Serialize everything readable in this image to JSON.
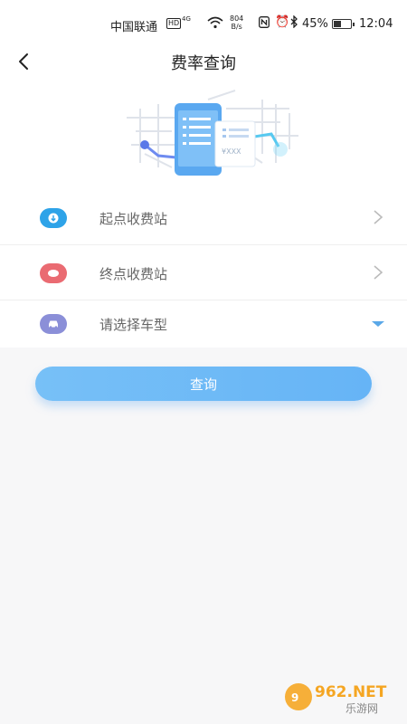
{
  "status": {
    "carrier": "中国联通",
    "hd": "HD",
    "network_type": "4G",
    "speed_value": "804",
    "speed_unit": "B/s",
    "battery": "45%",
    "battery_level": 0.45,
    "time": "12:04"
  },
  "header": {
    "title": "费率查询"
  },
  "hero": {
    "price_text": "¥XXX"
  },
  "form": {
    "start_station": "起点收费站",
    "end_station": "终点收费站",
    "vehicle_type": "请选择车型"
  },
  "query_button": "查询",
  "watermark": {
    "brand": "962.NET",
    "subtitle": "乐游网"
  },
  "colors": {
    "start_icon": "#2ea3e8",
    "end_icon": "#ea6b72",
    "vehicle_icon": "#8b8fd8",
    "accent": "#6cb8f6"
  }
}
